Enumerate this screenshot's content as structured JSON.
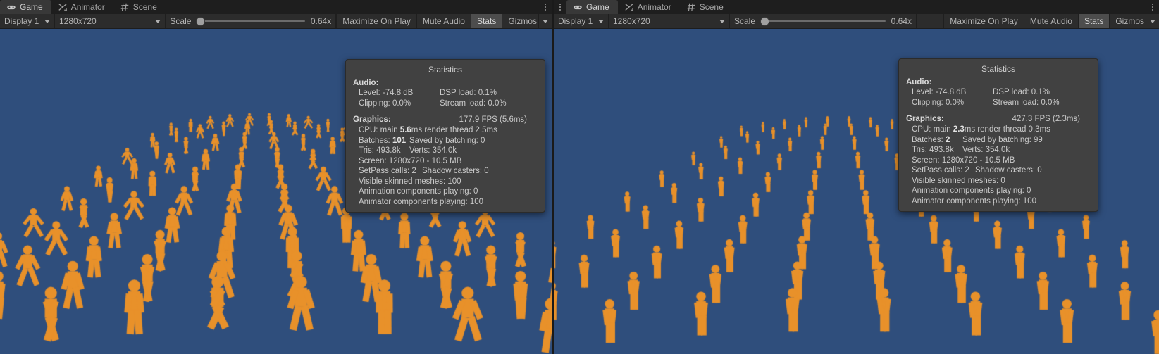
{
  "panes": [
    {
      "id": "left",
      "tabs": [
        {
          "label": "Game",
          "icon": "gamepad-icon",
          "active": true
        },
        {
          "label": "Animator",
          "icon": "animator-icon",
          "active": false
        },
        {
          "label": "Scene",
          "icon": "grid-icon",
          "active": false
        }
      ],
      "toolbar": {
        "display": "Display 1",
        "resolution": "1280x720",
        "scale_label": "Scale",
        "scale_value": "0.64x",
        "maximize_on_play": "Maximize On Play",
        "mute_audio": "Mute Audio",
        "stats": "Stats",
        "stats_active": true,
        "gizmos": "Gizmos"
      },
      "stats": {
        "title": "Statistics",
        "audio_heading": "Audio:",
        "level_label": "Level: -74.8 dB",
        "dsp_label": "DSP load: 0.1%",
        "clipping_label": "Clipping: 0.0%",
        "stream_label": "Stream load: 0.0%",
        "graphics_heading": "Graphics:",
        "fps": "177.9 FPS (5.6ms)",
        "cpu_prefix": "CPU: main ",
        "cpu_main": "5.6",
        "cpu_suffix": "ms  render thread 2.5ms",
        "batches_label": "Batches: ",
        "batches_value": "101",
        "saved_by_batching": "Saved by batching: 0",
        "tris": "Tris: 493.8k",
        "verts": "Verts: 354.0k",
        "screen": "Screen: 1280x720 - 10.5 MB",
        "setpass": "SetPass calls: 2",
        "shadow_casters": "Shadow casters: 0",
        "visible_skinned": "Visible skinned meshes: 100",
        "animation_components": "Animation components playing: 0",
        "animator_components": "Animator components playing: 100"
      },
      "crowd": {
        "rows": 10,
        "cols": 10,
        "pose": "running",
        "scale": 1.0
      }
    },
    {
      "id": "right",
      "tabs": [
        {
          "label": "Game",
          "icon": "gamepad-icon",
          "active": true
        },
        {
          "label": "Animator",
          "icon": "animator-icon",
          "active": false
        },
        {
          "label": "Scene",
          "icon": "grid-icon",
          "active": false
        }
      ],
      "toolbar": {
        "display": "Display 1",
        "resolution": "1280x720",
        "scale_label": "Scale",
        "scale_value": "0.64x",
        "maximize_on_play": "Maximize On Play",
        "mute_audio": "Mute Audio",
        "stats": "Stats",
        "stats_active": true,
        "gizmos": "Gizmos"
      },
      "stats": {
        "title": "Statistics",
        "audio_heading": "Audio:",
        "level_label": "Level: -74.8 dB",
        "dsp_label": "DSP load: 0.1%",
        "clipping_label": "Clipping: 0.0%",
        "stream_label": "Stream load: 0.0%",
        "graphics_heading": "Graphics:",
        "fps": "427.3 FPS (2.3ms)",
        "cpu_prefix": "CPU: main ",
        "cpu_main": "2.3",
        "cpu_suffix": "ms  render thread 0.3ms",
        "batches_label": "Batches: ",
        "batches_value": "2",
        "saved_by_batching": "Saved by batching: 99",
        "tris": "Tris: 493.8k",
        "verts": "Verts: 354.0k",
        "screen": "Screen: 1280x720 - 10.5 MB",
        "setpass": "SetPass calls: 2",
        "shadow_casters": "Shadow casters: 0",
        "visible_skinned": "Visible skinned meshes: 0",
        "animation_components": "Animation components playing: 0",
        "animator_components": "Animator components playing: 100"
      },
      "crowd": {
        "rows": 10,
        "cols": 10,
        "pose": "idle",
        "scale": 0.78
      }
    }
  ],
  "colors": {
    "game_background": "#2F4E7C",
    "character": "#E8912A",
    "character_shadow": "#B4701E",
    "panel_background": "#414141",
    "toolbar_background": "#2C2C2C",
    "tab_active": "#383838",
    "editor_background": "#1E1E1E",
    "stats_active_button": "#4D4D4D"
  }
}
